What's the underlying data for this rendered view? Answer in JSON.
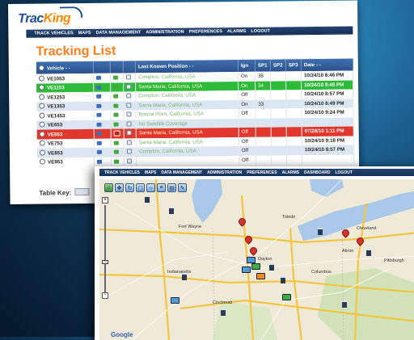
{
  "app": {
    "logo_main": "Trac",
    "logo_accent": "King"
  },
  "nav": {
    "items": [
      "TRACK VEHICLES",
      "MAPS",
      "DATA MANAGEMENT",
      "ADMINISTRATION",
      "PREFERENCES",
      "ALARMS",
      "LOGOUT"
    ]
  },
  "nav_map": {
    "items": [
      "TRACK VEHICLES",
      "MAPS",
      "DATA MANAGEMENT",
      "ADMINISTRATION",
      "PREFERENCES",
      "ALARMS",
      "DASHBOARD",
      "LOGOUT"
    ]
  },
  "tracking": {
    "title": "Tracking List",
    "columns": {
      "vehicle": "Vehicle - -",
      "position": "Last Known Position - -",
      "ign": "Ign",
      "sp1": "SP1",
      "sp2": "SP2",
      "sp3": "SP3",
      "date": "Date - -"
    },
    "rows": [
      {
        "vehicle": "VE1053",
        "position": "Compton, California, USA",
        "ign": "On",
        "sp1": "38",
        "date": "10/24/10 8:46 PM",
        "style": "white"
      },
      {
        "vehicle": "VE1153",
        "position": "Santa Maria, California, USA",
        "ign": "On",
        "sp1": "34",
        "date": "10/24/10 8:48 PM",
        "style": "green"
      },
      {
        "vehicle": "VE1253",
        "position": "Compton, California, USA",
        "ign": "Off",
        "sp1": "",
        "date": "10/24/10 8:57 PM",
        "style": "white"
      },
      {
        "vehicle": "VE1353",
        "position": "Santa Maria, California, USA",
        "ign": "On",
        "sp1": "33",
        "date": "10/24/10 8:49 PM",
        "style": "blue"
      },
      {
        "vehicle": "VE1453",
        "position": "Bowral Point, California, USA",
        "ign": "Off",
        "sp1": "",
        "date": "10/24/10 9:24 PM",
        "style": "white"
      },
      {
        "vehicle": "VE653",
        "position": "No Satellite Coverage",
        "ign": "",
        "sp1": "",
        "date": "",
        "style": "blue"
      },
      {
        "vehicle": "VE553",
        "position": "Santa Maria, California, USA",
        "ign": "Off",
        "sp1": "",
        "date": "07/28/10 1:11 PM",
        "style": "red"
      },
      {
        "vehicle": "VE753",
        "position": "Santa Maria, California, USA",
        "ign": "Off",
        "sp1": "",
        "date": "10/24/10 9:18 PM",
        "style": "white"
      },
      {
        "vehicle": "VE853",
        "position": "Compton, California, USA",
        "ign": "Off",
        "sp1": "",
        "date": "10/24/10 8:57 PM",
        "style": "blue"
      },
      {
        "vehicle": "VE953",
        "position": "",
        "ign": "Off",
        "sp1": "",
        "date": "",
        "style": "white"
      }
    ],
    "table_key": "Table Key:"
  },
  "map": {
    "attribution": "Google",
    "zoom_in": "+",
    "zoom_out": "-",
    "place_labels": [
      "Fort Wayne",
      "Indianapolis",
      "Cincinnati",
      "Columbus",
      "Dayton",
      "Pittsburgh",
      "Cleveland",
      "Toledo",
      "Akron"
    ],
    "colors": {
      "land": "#efe9d7",
      "water": "#a9c8ea",
      "highway": "#f3c640",
      "pin": "#d9342b",
      "forest": "#c9dfb0"
    }
  }
}
